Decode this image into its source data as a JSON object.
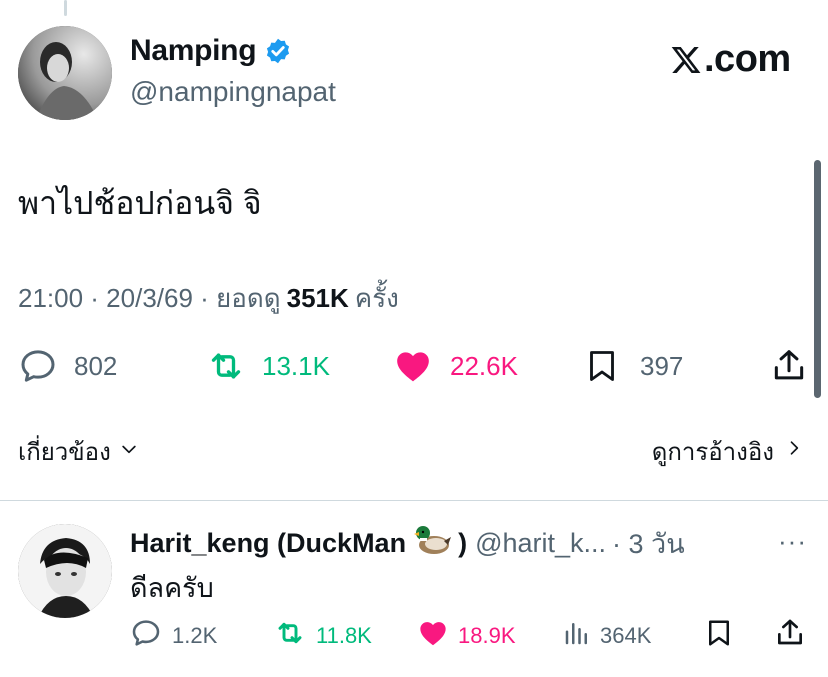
{
  "tweet": {
    "author_name": "Namping",
    "author_handle": "@nampingnapat",
    "brand": ".com",
    "text": "พาไปช้อปก่อนจิ จิ",
    "time": "21:00 · 20/3/69 · ยอดดู",
    "views": "351K",
    "views_suffix": "ครั้ง",
    "counts": {
      "replies": "802",
      "reposts": "13.1K",
      "likes": "22.6K",
      "bookmarks": "397"
    }
  },
  "links": {
    "related": "เกี่ยวข้อง",
    "quotes": "ดูการอ้างอิง"
  },
  "reply": {
    "author_name": "Harit_keng (DuckMan",
    "emoji": "🦆",
    "close_paren": ")",
    "author_handle": "@harit_k...",
    "time": "· 3 วัน",
    "more": "···",
    "text": "ดีลครับ",
    "counts": {
      "replies": "1.2K",
      "reposts": "11.8K",
      "likes": "18.9K",
      "views": "364K"
    }
  },
  "colors": {
    "verified": "#1d9bf0",
    "repost": "#00ba7c",
    "like": "#f91880",
    "muted": "#536471",
    "text": "#0f1419"
  },
  "icons": [
    "verified-badge-icon",
    "x-logo-icon",
    "reply-icon",
    "repost-icon",
    "like-icon",
    "bookmark-icon",
    "share-icon",
    "views-icon",
    "chevron-down-icon",
    "chevron-right-icon",
    "more-icon"
  ]
}
